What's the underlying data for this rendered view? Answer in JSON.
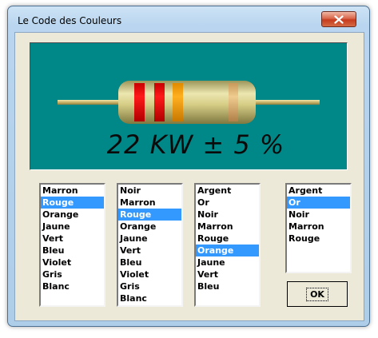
{
  "window": {
    "title": "Le Code des Couleurs"
  },
  "display": {
    "value_text": "22 KW ± 5 %",
    "background_color": "#008787",
    "resistor": {
      "body_color": "#d6ce86",
      "band_colors": [
        "#ff0000",
        "#ff0000",
        "#ffa000",
        "#e0b070"
      ]
    }
  },
  "lists": [
    {
      "items": [
        "Marron",
        "Rouge",
        "Orange",
        "Jaune",
        "Vert",
        "Bleu",
        "Violet",
        "Gris",
        "Blanc"
      ],
      "selected": "Rouge"
    },
    {
      "items": [
        "Noir",
        "Marron",
        "Rouge",
        "Orange",
        "Jaune",
        "Vert",
        "Bleu",
        "Violet",
        "Gris",
        "Blanc"
      ],
      "selected": "Rouge"
    },
    {
      "items": [
        "Argent",
        "Or",
        "Noir",
        "Marron",
        "Rouge",
        "Orange",
        "Jaune",
        "Vert",
        "Bleu"
      ],
      "selected": "Orange"
    },
    {
      "items": [
        "Argent",
        "Or",
        "Noir",
        "Marron",
        "Rouge"
      ],
      "selected": "Or"
    }
  ],
  "buttons": {
    "ok_label": "OK"
  },
  "icons": {
    "close": "close-icon"
  },
  "colors": {
    "selection": "#3399ff",
    "dialog_face": "#ece9d8"
  }
}
